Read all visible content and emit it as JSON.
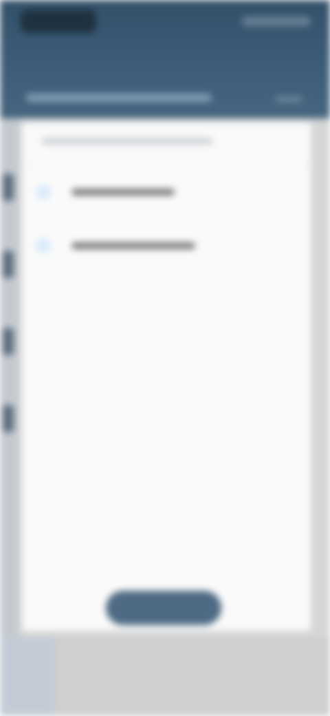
{
  "header": {
    "back_icon": "back-arrow-icon",
    "title": "",
    "status": "",
    "subtitle": ""
  },
  "dialog": {
    "title": "",
    "options": [
      {
        "label": "",
        "icon": "radio-icon",
        "selected": false
      },
      {
        "label": "",
        "icon": "radio-icon",
        "selected": false
      }
    ],
    "confirm_label": ""
  },
  "colors": {
    "header": "#3d5d78",
    "accent": "#4e6a84",
    "radio": "#d9ebfb",
    "card": "#fafafa",
    "backdrop": "#d6d6d6"
  }
}
